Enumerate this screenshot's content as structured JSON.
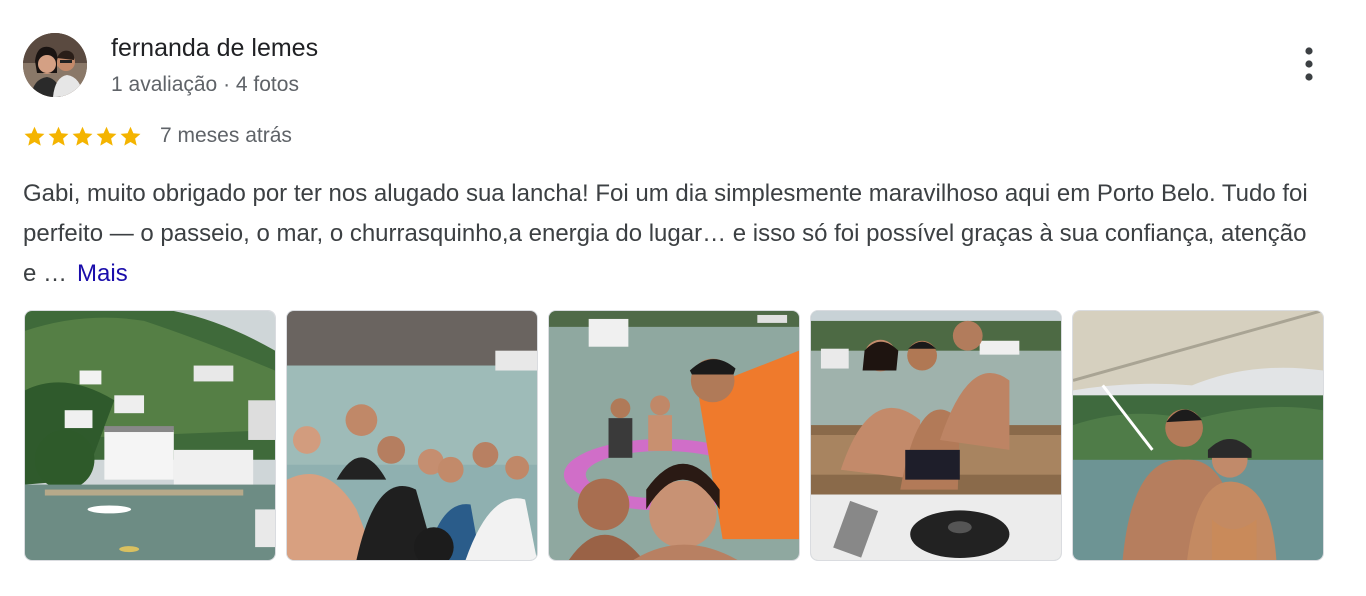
{
  "review": {
    "author": {
      "name": "fernanda de lemes",
      "meta": "1 avaliação · 4 fotos",
      "avatar": "avatar-photo"
    },
    "rating": {
      "stars": 5,
      "max": 5,
      "relative_date": "7 meses atrás",
      "star_color": "#f4b400"
    },
    "text": "Gabi, muito obrigado por ter nos alugado sua lancha! Foi um dia simplesmente maravilhoso aqui em Porto Belo. Tudo foi perfeito — o passeio, o mar, o churrasquinho,a energia do lugar… e isso só foi possível graças à sua confiança, atenção e …",
    "more_label": "Mais",
    "menu_icon": "more-vert-icon",
    "photos": [
      {
        "name": "photo-coastline-houses"
      },
      {
        "name": "photo-group-selfie"
      },
      {
        "name": "photo-boat-selfie-float"
      },
      {
        "name": "photo-family-on-boat"
      },
      {
        "name": "photo-couple-under-canopy"
      }
    ]
  }
}
